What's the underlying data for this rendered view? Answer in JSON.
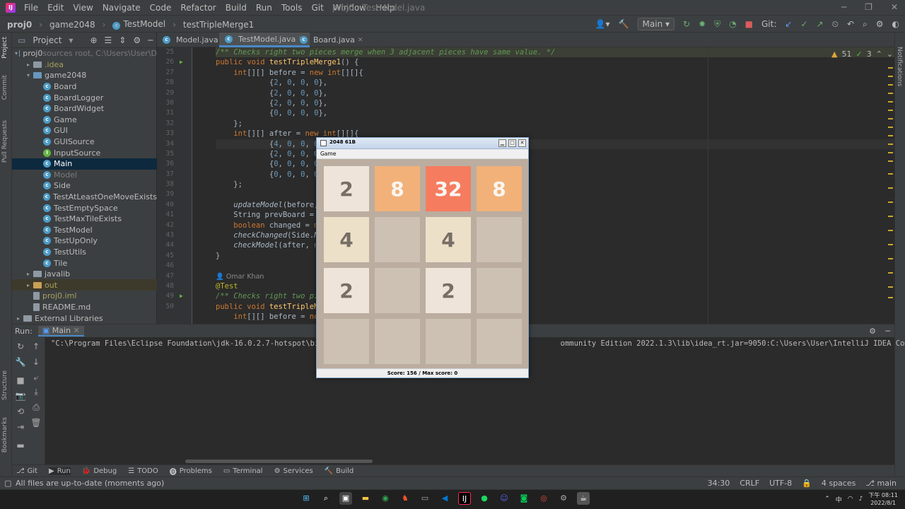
{
  "menu": [
    "File",
    "Edit",
    "View",
    "Navigate",
    "Code",
    "Refactor",
    "Build",
    "Run",
    "Tools",
    "Git",
    "Window",
    "Help"
  ],
  "window_title": "proj0 - TestModel.java",
  "breadcrumbs": [
    "proj0",
    "game2048",
    "TestModel",
    "testTripleMerge1"
  ],
  "run_config": "Main",
  "git_label": "Git:",
  "project_header": "Project",
  "project_tree": [
    {
      "label": "proj0",
      "suffix": "sources root, C:\\Users\\User\\D",
      "indent": 0,
      "arrow": "▾",
      "icon": "folder-b"
    },
    {
      "label": ".idea",
      "indent": 1,
      "arrow": "▸",
      "icon": "folder",
      "cls": "olive"
    },
    {
      "label": "game2048",
      "indent": 1,
      "arrow": "▾",
      "icon": "folder-b"
    },
    {
      "label": "Board",
      "indent": 2,
      "icon": "class"
    },
    {
      "label": "BoardLogger",
      "indent": 2,
      "icon": "class"
    },
    {
      "label": "BoardWidget",
      "indent": 2,
      "icon": "class"
    },
    {
      "label": "Game",
      "indent": 2,
      "icon": "class"
    },
    {
      "label": "GUI",
      "indent": 2,
      "icon": "class"
    },
    {
      "label": "GUISource",
      "indent": 2,
      "icon": "class"
    },
    {
      "label": "InputSource",
      "indent": 2,
      "icon": "interface"
    },
    {
      "label": "Main",
      "indent": 2,
      "icon": "class",
      "sel": true
    },
    {
      "label": "Model",
      "indent": 2,
      "icon": "class",
      "cls": "dim"
    },
    {
      "label": "Side",
      "indent": 2,
      "icon": "class"
    },
    {
      "label": "TestAtLeastOneMoveExists",
      "indent": 2,
      "icon": "class"
    },
    {
      "label": "TestEmptySpace",
      "indent": 2,
      "icon": "class"
    },
    {
      "label": "TestMaxTileExists",
      "indent": 2,
      "icon": "class"
    },
    {
      "label": "TestModel",
      "indent": 2,
      "icon": "class"
    },
    {
      "label": "TestUpOnly",
      "indent": 2,
      "icon": "class"
    },
    {
      "label": "TestUtils",
      "indent": 2,
      "icon": "class"
    },
    {
      "label": "Tile",
      "indent": 2,
      "icon": "class"
    },
    {
      "label": "javalib",
      "indent": 1,
      "arrow": "▸",
      "icon": "folder"
    },
    {
      "label": "out",
      "indent": 1,
      "arrow": "▸",
      "icon": "folder-o",
      "cls": "olive",
      "hl": true
    },
    {
      "label": "proj0.iml",
      "indent": 1,
      "icon": "file",
      "cls": "olive"
    },
    {
      "label": "README.md",
      "indent": 1,
      "icon": "file"
    },
    {
      "label": "External Libraries",
      "indent": 0,
      "arrow": "▸",
      "icon": "lib"
    }
  ],
  "tabs": [
    {
      "label": "Model.java"
    },
    {
      "label": "TestModel.java",
      "active": true
    },
    {
      "label": "Board.java"
    }
  ],
  "line_numbers": [
    "25",
    "26",
    "27",
    "28",
    "29",
    "30",
    "31",
    "32",
    "33",
    "34",
    "35",
    "36",
    "37",
    "38",
    "39",
    "40",
    "41",
    "42",
    "43",
    "44",
    "45",
    "46",
    "47",
    "48",
    "49",
    "50"
  ],
  "code_lines": [
    {
      "h": "<span class='cm'>/** Checks right two pieces merge when 3 adjacent pieces have same value. */</span>"
    },
    {
      "h": "<span class='kw'>public void </span><span class='fn'>testTripleMerge1</span>() {"
    },
    {
      "h": "    <span class='kw'>int</span>[][] before = <span class='kw'>new int</span>[][]{"
    },
    {
      "h": "            {<span class='num'>2</span>, <span class='num'>0</span>, <span class='num'>0</span>, <span class='num'>0</span>},"
    },
    {
      "h": "            {<span class='num'>2</span>, <span class='num'>0</span>, <span class='num'>0</span>, <span class='num'>0</span>},"
    },
    {
      "h": "            {<span class='num'>2</span>, <span class='num'>0</span>, <span class='num'>0</span>, <span class='num'>0</span>},"
    },
    {
      "h": "            {<span class='num'>0</span>, <span class='num'>0</span>, <span class='num'>0</span>, <span class='num'>0</span>},"
    },
    {
      "h": "    };"
    },
    {
      "h": "    <span class='kw'>int</span>[][] after = <span class='kw'>new int</span>[][]{"
    },
    {
      "h": "            {<span class='num'>4</span>, <span class='num'>0</span>, <span class='num'>0</span>, <span class='num'>0</span>}",
      "cur": true
    },
    {
      "h": "            {<span class='num'>2</span>, <span class='num'>0</span>, <span class='num'>0</span>, <span class='num'>0</span>}"
    },
    {
      "h": "            {<span class='num'>0</span>, <span class='num'>0</span>, <span class='num'>0</span>, <span class='num'>0</span>}"
    },
    {
      "h": "            {<span class='num'>0</span>, <span class='num'>0</span>, <span class='num'>0</span>, <span class='num'>0</span>}"
    },
    {
      "h": "    };"
    },
    {
      "h": ""
    },
    {
      "h": "    <span class='it'>updateModel</span>(before,"
    },
    {
      "h": "    String prevBoard = <span class='kw'>m</span>"
    },
    {
      "h": "    <span class='kw'>boolean</span> changed = <span class='kw'>mo</span>"
    },
    {
      "h": "    <span class='it'>checkChanged</span>(Side.<span class='it'>NO</span>"
    },
    {
      "h": "    <span class='it'>checkModel</span>(after, <span class='hint'>m</span>"
    },
    {
      "h": "}"
    },
    {
      "h": ""
    },
    {
      "h": "<span class='hint'>👤 Omar Khan</span>"
    },
    {
      "h": "<span class='an'>@Test</span>"
    },
    {
      "h": "<span class='cm'>/** Checks right two pie</span>                                          <span class='cm'>*/</span>"
    },
    {
      "h": "<span class='kw'>public void </span><span class='fn'>testTripleMe</span>"
    },
    {
      "h": "    <span class='kw'>int</span>[][] before = <span class='kw'>new</span>"
    }
  ],
  "inspections": {
    "warnings": "51",
    "weak": "3"
  },
  "run_panel": {
    "label": "Run:",
    "config": "Main"
  },
  "console_line": "\"C:\\Program Files\\Eclipse Foundation\\jdk-16.0.2.7-hotspot\\bin\\j                                                   ommunity Edition 2022.1.3\\lib\\idea_rt.jar=9050:C:\\Users\\User\\IntelliJ IDEA Community E",
  "tool_windows": [
    {
      "icon": "⎇",
      "label": "Git"
    },
    {
      "icon": "▶",
      "label": "Run",
      "active": true
    },
    {
      "icon": "🐞",
      "label": "Debug"
    },
    {
      "icon": "☰",
      "label": "TODO"
    },
    {
      "icon": "⓿",
      "label": "Problems"
    },
    {
      "icon": "▭",
      "label": "Terminal"
    },
    {
      "icon": "⚙",
      "label": "Services"
    },
    {
      "icon": "🔨",
      "label": "Build"
    }
  ],
  "status_message": "All files are up-to-date (moments ago)",
  "status_right": [
    "34:30",
    "CRLF",
    "UTF-8",
    "4 spaces",
    "main"
  ],
  "side_labels": {
    "project": "Project",
    "commit": "Commit",
    "pull_requests": "Pull Requests",
    "structure": "Structure",
    "bookmarks": "Bookmarks",
    "notifications": "Notifications"
  },
  "taskbar": {
    "time": "下午 08:11",
    "date": "2022/8/1",
    "ime": "中"
  },
  "game": {
    "title": "2048 61B",
    "menu": "Game",
    "status": "Score:    156 / Max score:     0",
    "tiles": [
      [
        2,
        8,
        32,
        8
      ],
      [
        4,
        0,
        4,
        0
      ],
      [
        2,
        0,
        2,
        0
      ],
      [
        0,
        0,
        0,
        0
      ]
    ]
  },
  "colors": {
    "accent": "#4a88c7",
    "tile2": "#eee4da",
    "tile4": "#ede0c8",
    "tile8": "#f2b179",
    "tile32": "#f67c5f",
    "empty": "#cdc1b4",
    "board": "#bbada0"
  }
}
